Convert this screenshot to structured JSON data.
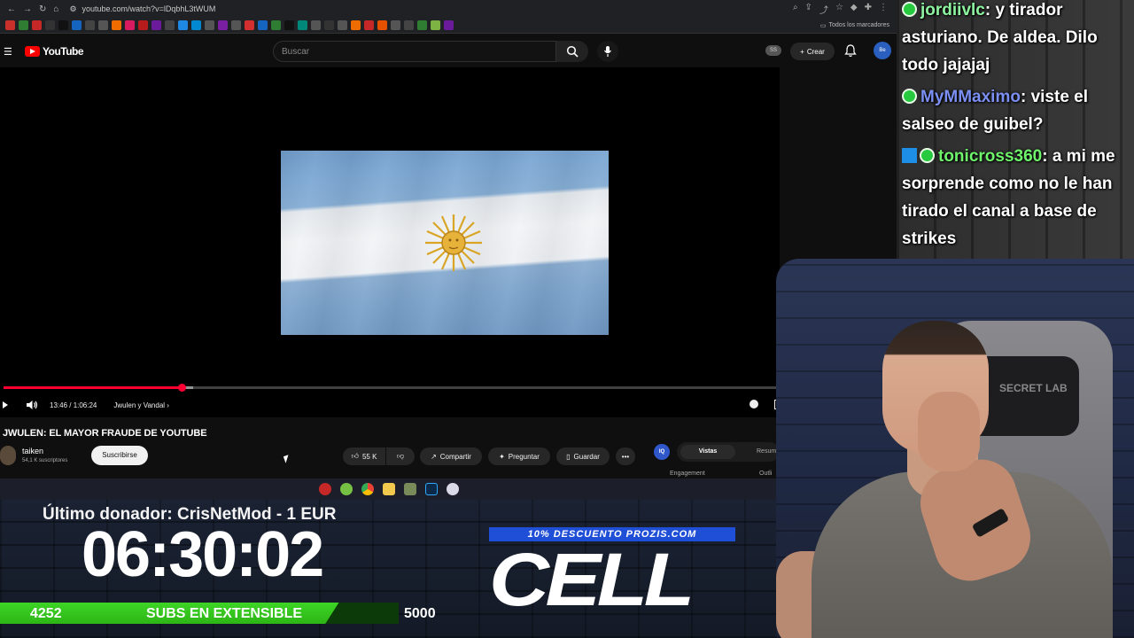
{
  "browser": {
    "url": "youtube.com/watch?v=lDqbhL3tWUM",
    "bookmarks_folder": "Todos los marcadores"
  },
  "youtube": {
    "logo_text": "YouTube",
    "search_placeholder": "Buscar",
    "ss_badge": "SS",
    "create_label": "Crear",
    "avatar_text": "Be"
  },
  "player": {
    "current_time": "13:46",
    "duration": "1:06:24",
    "time_display": "13:46 / 1:06:24",
    "chapter": "Jwulen y Vandal",
    "progress_fraction": 0.23,
    "buffered_fraction": 0.245
  },
  "video": {
    "title": "JWULEN: EL MAYOR FRAUDE DE YOUTUBE",
    "channel": "taiken",
    "subscribers": "54,1 K suscriptores",
    "subscribe_label": "Suscribirse",
    "likes": "55 K",
    "share_label": "Compartir",
    "ask_label": "Preguntar",
    "save_label": "Guardar"
  },
  "side_panel": {
    "badge": "IQ",
    "tab_active": "Vistas",
    "tab_inactive": "Resum",
    "engagement_label": "Engagement",
    "outlier_label": "Outli"
  },
  "overlay": {
    "donor_text": "Último donador: CrisNetMod - 1 EUR",
    "timer": "06:30:02",
    "subs_current": "4252",
    "subs_label": "SUBS EN EXTENSIBLE",
    "subs_goal": "5000",
    "subs_fraction": 0.85,
    "promo": "10% DESCUENTO PROZIS.COM",
    "sponsor": "CELL"
  },
  "chat": {
    "messages": [
      {
        "user": "jordiivlc",
        "text": ": y tirador asturiano. De aldea. Dilo todo jajajaj"
      },
      {
        "user": "MyMMaximo",
        "text": ": viste el salseo de guibel?"
      },
      {
        "user": "tonicross360",
        "text": ": a mi me sorprende como no le han tirado el canal a base de strikes"
      }
    ]
  },
  "webcam": {
    "chair_logo": "SECRET LAB"
  },
  "colors": {
    "youtube_red": "#ff0000",
    "progress_red": "#ff0033",
    "subs_green": "#3ed526",
    "promo_blue": "#1f4fd6"
  }
}
